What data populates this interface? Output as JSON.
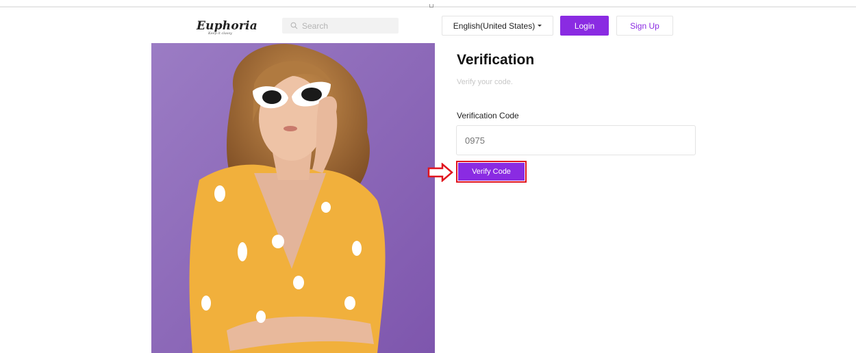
{
  "header": {
    "logo_text": "Euphoria",
    "logo_tagline": "Keep it classy",
    "search_placeholder": "Search",
    "language": "English(United States)",
    "login_label": "Login",
    "signup_label": "Sign Up"
  },
  "form": {
    "title": "Verification",
    "subtitle": "Verify your code.",
    "code_label": "Verification Code",
    "code_placeholder": "0975",
    "verify_label": "Verify Code"
  },
  "colors": {
    "accent": "#8a2be2",
    "highlight": "#e0141e"
  }
}
